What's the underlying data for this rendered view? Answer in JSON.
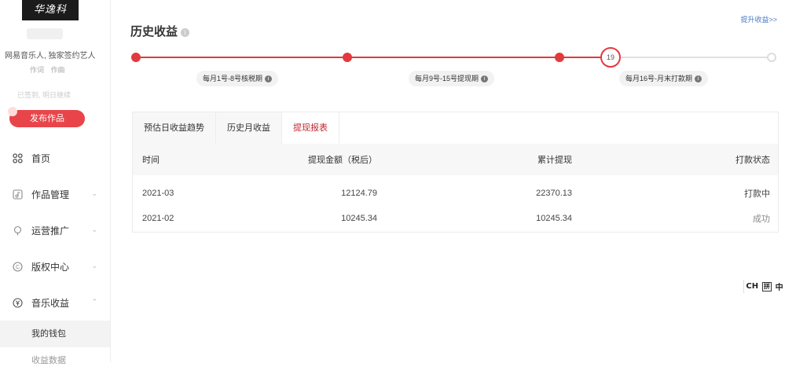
{
  "sidebar": {
    "brand_text": "华逸科",
    "artist_desc": "网易音乐人, 独家签约艺人",
    "tags": [
      "作词",
      "作曲"
    ],
    "signin_text": "已签到, 明日继续",
    "publish_label": "发布作品",
    "nav": [
      {
        "label": "首页",
        "icon": "grid-icon"
      },
      {
        "label": "作品管理",
        "icon": "music-doc-icon"
      },
      {
        "label": "运营推广",
        "icon": "pin-icon"
      },
      {
        "label": "版权中心",
        "icon": "copyright-icon"
      },
      {
        "label": "音乐收益",
        "icon": "yen-icon"
      }
    ],
    "sub_items": [
      "我的钱包",
      "收益数据"
    ]
  },
  "main": {
    "title": "历史收益",
    "upgrade_link": "提升收益>>",
    "timeline": {
      "current_day": "19",
      "phases": [
        "每月1号-8号核税期",
        "每月9号-15号提现期",
        "每月16号-月末打款期"
      ]
    },
    "tabs": [
      "预估日收益趋势",
      "历史月收益",
      "提现报表"
    ],
    "active_tab": "提现报表",
    "table": {
      "headers": [
        "时间",
        "提现金额（税后）",
        "累计提现",
        "打款状态"
      ],
      "rows": [
        {
          "time": "2021-03",
          "amount": "12124.79",
          "cumulative": "22370.13",
          "status": "打款中"
        },
        {
          "time": "2021-02",
          "amount": "10245.34",
          "cumulative": "10245.34",
          "status": "成功"
        }
      ]
    }
  },
  "ime": {
    "mode": "CH",
    "box": "拼",
    "lang": "中"
  },
  "colors": {
    "accent": "#e2393f",
    "active_tab": "#c0282e",
    "link": "#4a78c2"
  }
}
